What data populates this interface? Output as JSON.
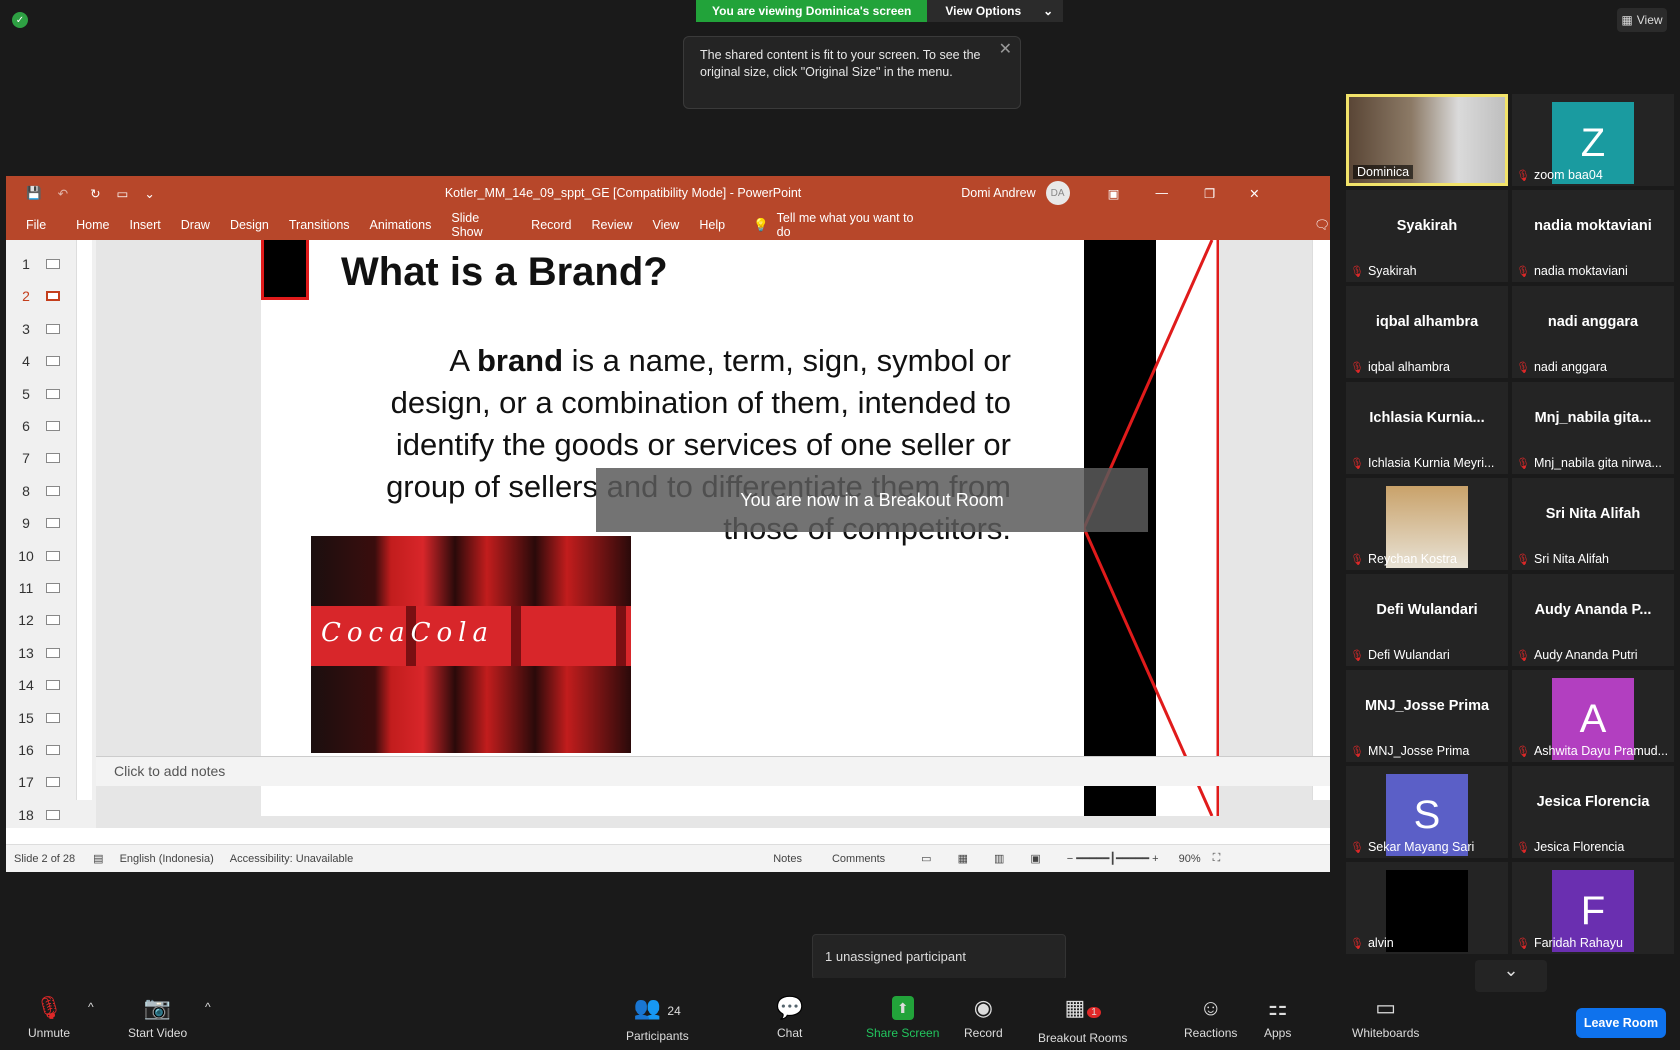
{
  "banner": {
    "viewing": "You are viewing Dominica's screen",
    "options": "View Options"
  },
  "toast": {
    "text": "The shared content is fit to your screen. To see the original size, click \"Original Size\" in the menu."
  },
  "view_label": "View",
  "ppt": {
    "title": "Kotler_MM_14e_09_sppt_GE [Compatibility Mode]  -  PowerPoint",
    "user": "Domi Andrew",
    "user_initials": "DA",
    "menu": [
      "File",
      "Home",
      "Insert",
      "Draw",
      "Design",
      "Transitions",
      "Animations",
      "Slide Show",
      "Record",
      "Review",
      "View",
      "Help"
    ],
    "tell_me": "Tell me what you want to do",
    "thumbs": [
      "1",
      "2",
      "3",
      "4",
      "5",
      "6",
      "7",
      "8",
      "9",
      "10",
      "11",
      "12",
      "13",
      "14",
      "15",
      "16",
      "17",
      "18"
    ],
    "slide_title": "What is a Brand?",
    "slide_text_pre": "A ",
    "slide_text_bold": "brand",
    "slide_text_post": " is a name, term, sign, symbol or design, or a combination of them, intended to identify the goods or services of one seller or group of sellers and to differentiate them from those of competitors.",
    "image_text": "CocaCola",
    "notes": "Click to add notes",
    "status": {
      "slide": "Slide 2 of 28",
      "language": "English (Indonesia)",
      "accessibility": "Accessibility: Unavailable",
      "notes": "Notes",
      "comments": "Comments",
      "zoom": "90%"
    }
  },
  "breakout_msg": "You are now in a Breakout Room",
  "participants": [
    {
      "big": "",
      "name": "Dominica",
      "type": "video",
      "muted": false
    },
    {
      "big": "Z",
      "name": "zoom baa04",
      "type": "avatar",
      "color": "#1a9ba0",
      "muted": true
    },
    {
      "big": "Syakirah",
      "name": "Syakirah",
      "type": "text",
      "muted": true
    },
    {
      "big": "nadia moktaviani",
      "name": "nadia moktaviani",
      "type": "text",
      "muted": true
    },
    {
      "big": "iqbal alhambra",
      "name": "iqbal alhambra",
      "type": "text",
      "muted": true
    },
    {
      "big": "nadi anggara",
      "name": "nadi anggara",
      "type": "text",
      "muted": true
    },
    {
      "big": "Ichlasia  Kurnia...",
      "name": "Ichlasia Kurnia Meyri...",
      "type": "text",
      "muted": true
    },
    {
      "big": "Mnj_nabila  gita...",
      "name": "Mnj_nabila gita nirwa...",
      "type": "text",
      "muted": true
    },
    {
      "big": "",
      "name": "Reychan Kostra",
      "type": "photo",
      "muted": true
    },
    {
      "big": "Sri Nita Alifah",
      "name": "Sri Nita Alifah",
      "type": "text",
      "muted": true
    },
    {
      "big": "Defi Wulandari",
      "name": "Defi Wulandari",
      "type": "text",
      "muted": true
    },
    {
      "big": "Audy  Ananda  P...",
      "name": "Audy Ananda Putri",
      "type": "text",
      "muted": true
    },
    {
      "big": "MNJ_Josse Prima",
      "name": "MNJ_Josse Prima",
      "type": "text",
      "muted": true
    },
    {
      "big": "A",
      "name": "Ashwita Dayu Pramud...",
      "type": "avatar",
      "color": "#b23fc0",
      "muted": true
    },
    {
      "big": "S",
      "name": "Sekar Mayang Sari",
      "type": "avatar",
      "color": "#5b5fc7",
      "muted": true
    },
    {
      "big": "Jesica Florencia",
      "name": "Jesica Florencia",
      "type": "text",
      "muted": true
    },
    {
      "big": "",
      "name": "alvin",
      "type": "black",
      "muted": true
    },
    {
      "big": "F",
      "name": "Faridah Rahayu",
      "type": "avatar",
      "color": "#6a2fb0",
      "muted": true
    }
  ],
  "unassigned": "1 unassigned participant",
  "toolbar": {
    "unmute": "Unmute",
    "start_video": "Start Video",
    "participants": "Participants",
    "participants_count": "24",
    "chat": "Chat",
    "share": "Share Screen",
    "record": "Record",
    "breakout": "Breakout Rooms",
    "breakout_badge": "1",
    "reactions": "Reactions",
    "apps": "Apps",
    "whiteboards": "Whiteboards",
    "leave": "Leave Room"
  }
}
